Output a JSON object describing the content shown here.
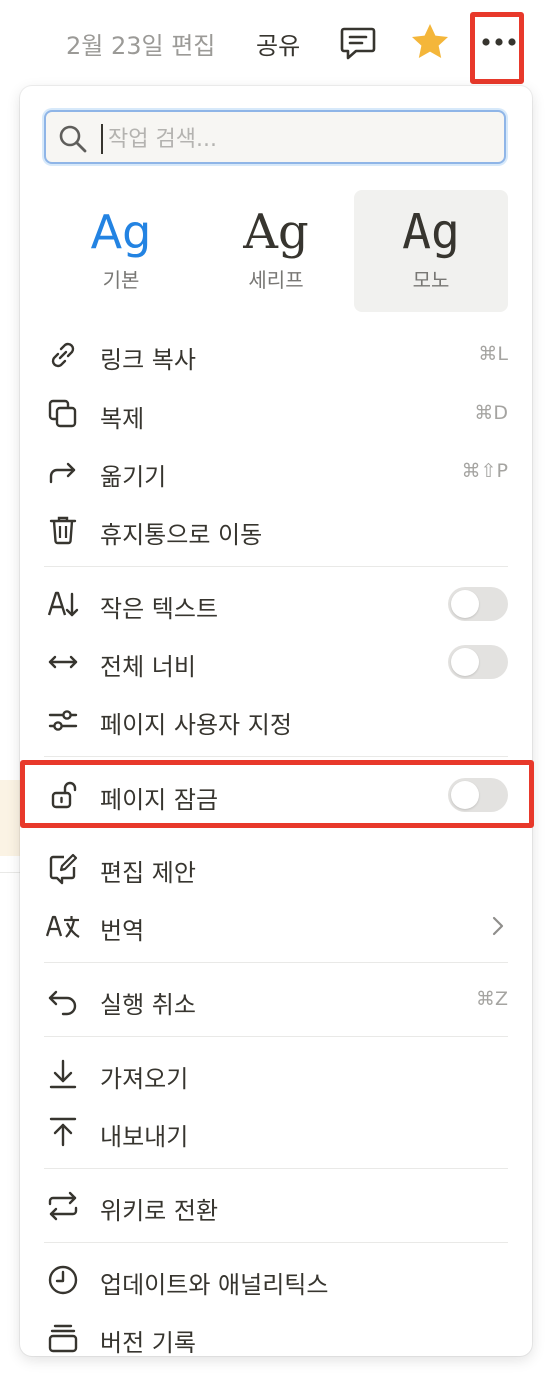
{
  "topbar": {
    "edited": "2월 23일 편집",
    "share": "공유",
    "icons": [
      "comment-icon",
      "star-icon",
      "more-icon"
    ],
    "star_color": "#f4b63a",
    "highlight_color": "#e8392b"
  },
  "search": {
    "placeholder": "작업 검색..."
  },
  "fonts": [
    {
      "glyph": "Ag",
      "label": "기본",
      "selected": false
    },
    {
      "glyph": "Ag",
      "label": "세리프",
      "selected": false
    },
    {
      "glyph": "Ag",
      "label": "모노",
      "selected": true
    }
  ],
  "accent_color": "#2383e2",
  "menu": {
    "copy_link": {
      "label": "링크 복사",
      "shortcut": "⌘L"
    },
    "duplicate": {
      "label": "복제",
      "shortcut": "⌘D"
    },
    "move": {
      "label": "옮기기",
      "shortcut": "⌘⇧P"
    },
    "trash": {
      "label": "휴지통으로 이동"
    },
    "small_text": {
      "label": "작은 텍스트",
      "on": false
    },
    "full_width": {
      "label": "전체 너비",
      "on": false
    },
    "customize": {
      "label": "페이지 사용자 지정"
    },
    "lock": {
      "label": "페이지 잠금",
      "on": false
    },
    "suggest": {
      "label": "편집 제안"
    },
    "translate": {
      "label": "번역"
    },
    "undo": {
      "label": "실행 취소",
      "shortcut": "⌘Z"
    },
    "import": {
      "label": "가져오기"
    },
    "export": {
      "label": "내보내기"
    },
    "wiki": {
      "label": "위키로 전환"
    },
    "analytics": {
      "label": "업데이트와 애널리틱스"
    },
    "history": {
      "label": "버전 기록"
    }
  }
}
